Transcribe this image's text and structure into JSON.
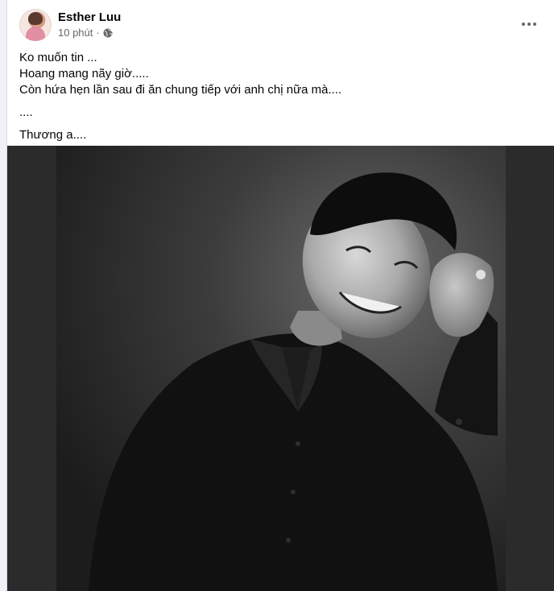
{
  "post": {
    "author": "Esther Luu",
    "time": "10 phút",
    "separator": "·",
    "privacy_icon": "globe-icon",
    "more_icon": "more-horizontal-icon",
    "text_lines": [
      "Ko muốn tin ...",
      "Hoang mang nãy giờ.....",
      "Còn hứa hẹn lần sau đi ăn chung tiếp với anh chị nữa mà....",
      "....",
      "Thương a...."
    ]
  },
  "colors": {
    "name_text": "#050505",
    "meta_text": "#65676b",
    "photo_bg": "#2b2b2b"
  }
}
